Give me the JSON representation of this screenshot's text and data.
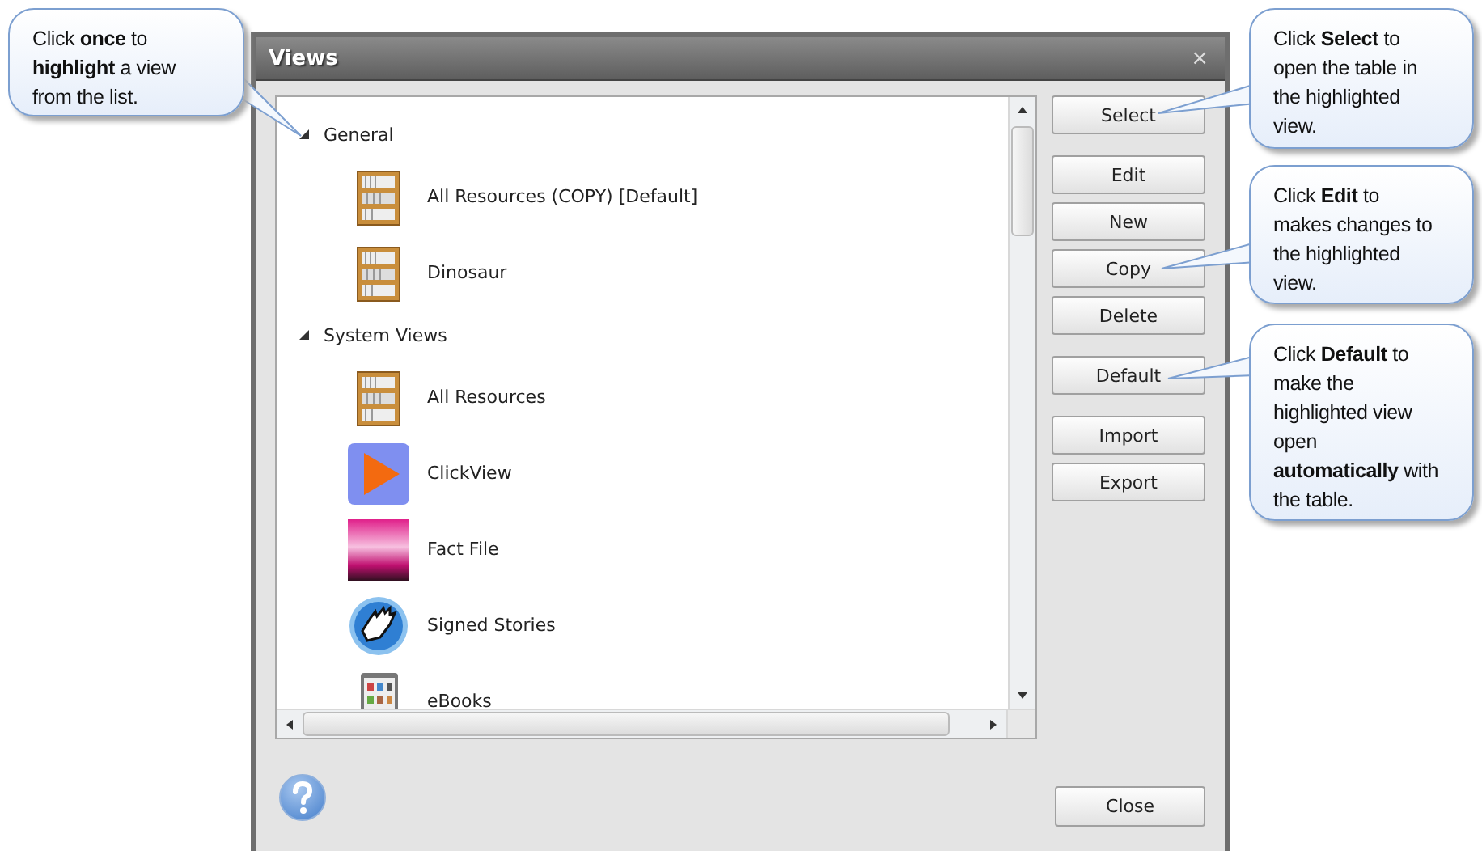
{
  "window": {
    "title": "Views",
    "close": "×"
  },
  "views_tree": [
    {
      "label": "General",
      "expanded": true,
      "children": [
        {
          "label": "All Resources (COPY) [Default]",
          "kind": "bookshelf"
        },
        {
          "label": "Dinosaur",
          "kind": "bookshelf"
        }
      ]
    },
    {
      "label": "System Views",
      "expanded": true,
      "children": [
        {
          "label": "All Resources",
          "kind": "bookshelf"
        },
        {
          "label": "ClickView",
          "kind": "play"
        },
        {
          "label": "Fact File",
          "kind": "picture"
        },
        {
          "label": "Signed Stories",
          "kind": "hands"
        },
        {
          "label": "eBooks",
          "kind": "tablet"
        }
      ]
    }
  ],
  "button_groups": [
    [
      "Select"
    ],
    [
      "Edit",
      "New",
      "Copy",
      "Delete"
    ],
    [
      "Default"
    ],
    [
      "Import",
      "Export"
    ]
  ],
  "close_button": "Close",
  "callouts": [
    {
      "text": "Click **once** to **highlight** a view from the list."
    },
    {
      "text": "Click **Select** to open the table in the highlighted view."
    },
    {
      "text": "Click **Edit** to makes changes to the highlighted view."
    },
    {
      "text": "Click **Default** to make the highlighted view open **automatically** with the table."
    }
  ]
}
